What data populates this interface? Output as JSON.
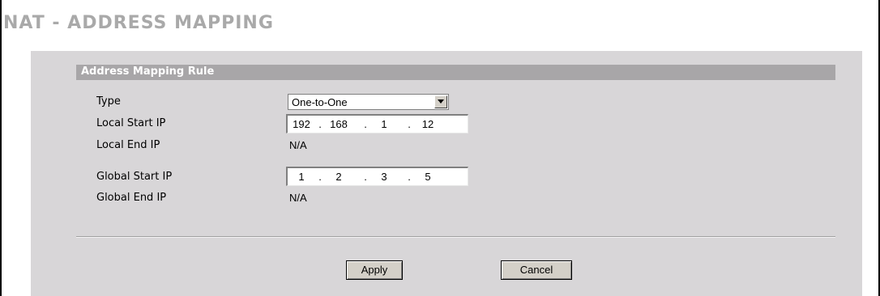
{
  "page": {
    "title": "NAT - ADDRESS MAPPING"
  },
  "section": {
    "title": "Address Mapping Rule"
  },
  "fields": {
    "type": {
      "label": "Type",
      "selected": "One-to-One"
    },
    "local_start_ip": {
      "label": "Local Start IP",
      "octets": [
        "192",
        "168",
        "1",
        "12"
      ]
    },
    "local_end_ip": {
      "label": "Local End IP",
      "value": "N/A"
    },
    "global_start_ip": {
      "label": "Global Start IP",
      "octets": [
        "1",
        "2",
        "3",
        "5"
      ]
    },
    "global_end_ip": {
      "label": "Global End IP",
      "value": "N/A"
    }
  },
  "separator": ".",
  "buttons": {
    "apply": "Apply",
    "cancel": "Cancel"
  },
  "icons": {
    "dropdown": "chevron-down-icon"
  },
  "colors": {
    "title": "#a9a9a9",
    "panel_background": "#d8d6d8",
    "section_bar": "#a8a6a8",
    "section_text": "#ffffff"
  }
}
